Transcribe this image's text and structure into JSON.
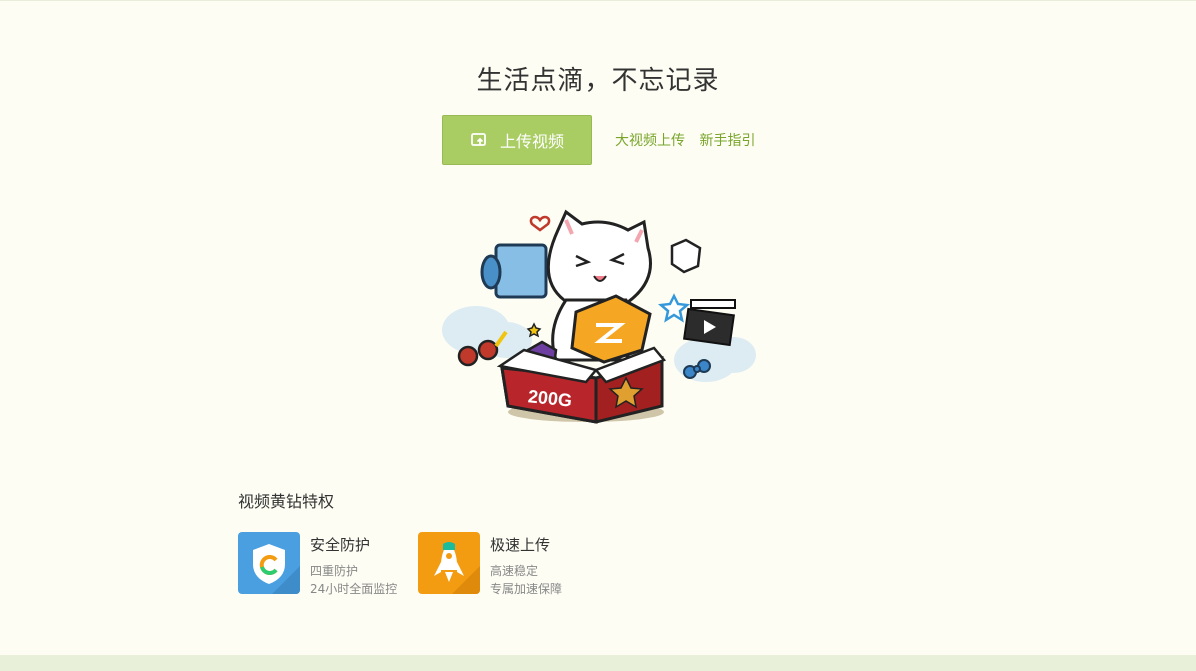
{
  "hero": {
    "headline": "生活点滴，不忘记录",
    "upload_label": "上传视频",
    "links": [
      "大视频上传",
      "新手指引"
    ],
    "box_label": "200G"
  },
  "privileges": {
    "title": "视频黄钻特权",
    "items": [
      {
        "title": "安全防护",
        "line1": "四重防护",
        "line2": "24小时全面监控",
        "color": "#4a9fe0",
        "icon": "shield-icon"
      },
      {
        "title": "极速上传",
        "line1": "高速稳定",
        "line2": "专属加速保障",
        "color": "#f39c12",
        "icon": "rocket-icon"
      }
    ]
  },
  "colors": {
    "accent": "#a9cc63",
    "link": "#79a52a",
    "background": "#fdfdf4"
  }
}
